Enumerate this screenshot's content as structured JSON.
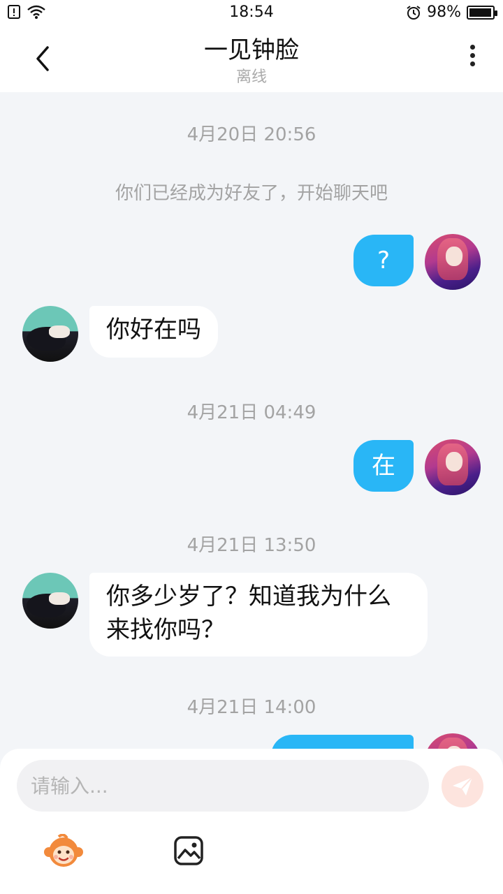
{
  "status_bar": {
    "time": "18:54",
    "battery_percent": "98%",
    "battery_level": 0.98,
    "icons": [
      "notification-alert-icon",
      "wifi-icon",
      "alarm-clock-icon",
      "battery-icon"
    ]
  },
  "header": {
    "title": "一见钟脸",
    "subtitle": "离线",
    "back_icon": "chevron-left-icon",
    "more_icon": "more-vertical-icon"
  },
  "chat": {
    "timestamps": [
      "4月20日 20:56",
      "4月21日 04:49",
      "4月21日 13:50",
      "4月21日 14:00"
    ],
    "system_message": "你们已经成为好友了，开始聊天吧",
    "messages": [
      {
        "sender": "self",
        "text": "?"
      },
      {
        "sender": "other",
        "text": "你好在吗"
      },
      {
        "sender": "self",
        "text": "在"
      },
      {
        "sender": "other",
        "text": "你多少岁了？知道我为什么来找你吗？"
      },
      {
        "sender": "self",
        "text": ""
      }
    ]
  },
  "input": {
    "placeholder": "请输入...",
    "value": "",
    "send_icon": "paper-plane-icon",
    "emoji_icon": "monkey-emoji-icon",
    "image_icon": "image-icon"
  },
  "colors": {
    "self_bubble": "#29b6f6",
    "other_bubble": "#ffffff",
    "background": "#f3f5f8",
    "muted_text": "#a3a3a3",
    "send_button": "#fde4de"
  }
}
